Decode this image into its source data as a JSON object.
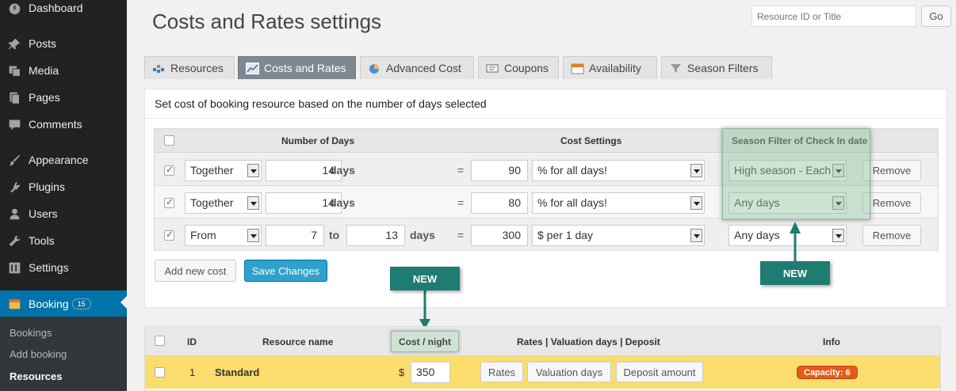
{
  "sidebar": {
    "items": [
      {
        "label": "Dashboard",
        "icon": "dashboard-icon"
      },
      {
        "label": "Posts",
        "icon": "pin-icon"
      },
      {
        "label": "Media",
        "icon": "media-icon"
      },
      {
        "label": "Pages",
        "icon": "pages-icon"
      },
      {
        "label": "Comments",
        "icon": "comment-icon"
      },
      {
        "label": "Appearance",
        "icon": "brush-icon"
      },
      {
        "label": "Plugins",
        "icon": "plug-icon"
      },
      {
        "label": "Users",
        "icon": "user-icon"
      },
      {
        "label": "Tools",
        "icon": "wrench-icon"
      },
      {
        "label": "Settings",
        "icon": "settings-icon"
      }
    ],
    "booking": {
      "label": "Booking",
      "badge": "15",
      "icon": "calendar-icon"
    },
    "submenu": [
      {
        "label": "Bookings"
      },
      {
        "label": "Add booking"
      },
      {
        "label": "Resources"
      }
    ]
  },
  "header": {
    "title": "Costs and Rates settings",
    "search_placeholder": "Resource ID or Title",
    "go_label": "Go"
  },
  "tabs": [
    {
      "label": "Resources"
    },
    {
      "label": "Costs and Rates"
    },
    {
      "label": "Advanced Cost"
    },
    {
      "label": "Coupons"
    },
    {
      "label": "Availability"
    },
    {
      "label": "Season Filters"
    }
  ],
  "costs": {
    "heading": "Set cost of booking resource based on the number of days selected",
    "columns": {
      "days": "Number of Days",
      "cost": "Cost Settings",
      "season": "Season Filter of Check In date"
    },
    "rows": [
      {
        "mode": "Together",
        "days": "14",
        "to_days": "",
        "unit": "days",
        "eq": "=",
        "cost": "90",
        "cost_type": "% for all days!",
        "season": "High season - Each",
        "remove": "Remove"
      },
      {
        "mode": "Together",
        "days": "14",
        "to_days": "",
        "unit": "days",
        "eq": "=",
        "cost": "80",
        "cost_type": "% for all days!",
        "season": "Any days",
        "remove": "Remove"
      },
      {
        "mode": "From",
        "days": "7",
        "to_label": "to",
        "to_days": "13",
        "unit": "days",
        "eq": "=",
        "cost": "300",
        "cost_type": "$ per 1 day",
        "season": "Any days",
        "remove": "Remove"
      }
    ],
    "add_label": "Add new cost",
    "save_label": "Save Changes"
  },
  "annotations": {
    "new_label": "NEW",
    "color": "#1f7c72"
  },
  "resources": {
    "columns": {
      "id": "ID",
      "name": "Resource name",
      "cost": "Cost / night",
      "rates": "Rates | Valuation days | Deposit",
      "info": "Info"
    },
    "row": {
      "id": "1",
      "name": "Standard",
      "currency": "$",
      "cost": "350",
      "rates_btn": "Rates",
      "valuation_btn": "Valuation days",
      "deposit_btn": "Deposit amount",
      "capacity": "Capacity: 6"
    }
  },
  "colors": {
    "sidebar": "#222222",
    "active_menu": "#0073aa",
    "primary_button": "#2ea2cc",
    "row_highlight": "#fbdd6e",
    "capacity_badge": "#e35b17"
  }
}
